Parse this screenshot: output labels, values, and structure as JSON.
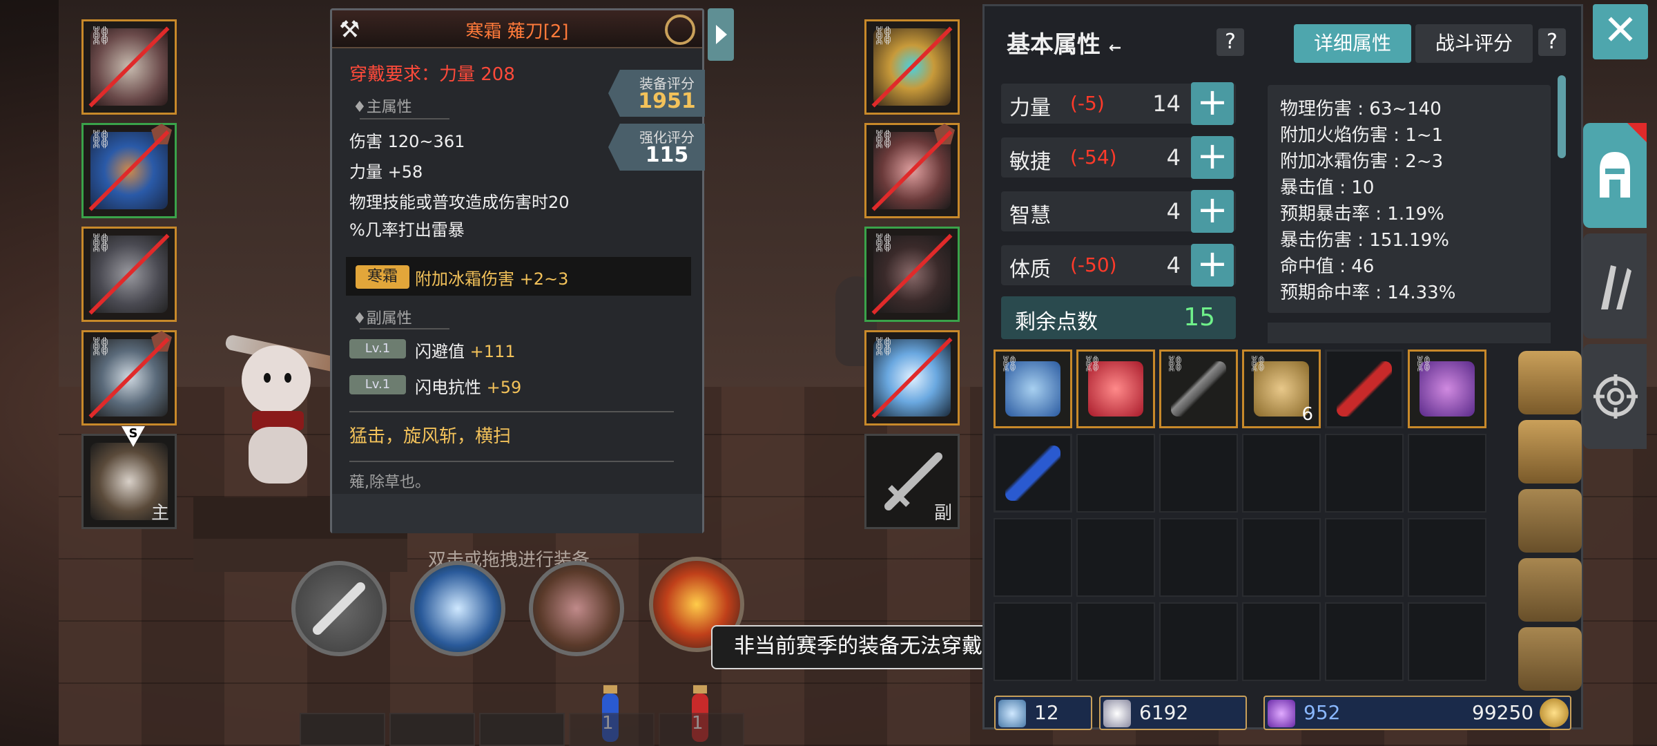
{
  "item": {
    "name": "寒霜 薙刀[2]",
    "requirement": "穿戴要求：力量 208",
    "main_attr_title": "♦主属性",
    "damage": "伤害  120~361",
    "strength": "力量 +58",
    "effect_line1": "物理技能或普攻造成伤害时20",
    "effect_line2": "%几率打出雷暴",
    "frost_badge": "寒霜",
    "frost_bonus": "附加冰霜伤害 +2~3",
    "sub_attr_title": "♦副属性",
    "sub_attrs": [
      {
        "lv": "Lv.1",
        "name": "闪避值 ",
        "value": "+111"
      },
      {
        "lv": "Lv.1",
        "name": "闪电抗性 ",
        "value": "+59"
      }
    ],
    "skills": "猛击，旋风斩，横扫",
    "lore": "薙,除草也。",
    "equip_score_label": "装备评分",
    "equip_score": "1951",
    "enhance_score_label": "强化评分",
    "enhance_score": "115"
  },
  "equip_hint": "双击或拖拽进行装备",
  "toast": "非当前赛季的装备无法穿戴",
  "slots": {
    "main_label": "主",
    "off_label": "副",
    "weapon_grade": "S"
  },
  "potions": [
    {
      "count": "1"
    },
    {
      "count": "1"
    }
  ],
  "stats_panel": {
    "title": "基本属性",
    "tab_detail": "详细属性",
    "tab_battle": "战斗评分",
    "help": "?",
    "stats": [
      {
        "name": "力量",
        "mod": "(-5)",
        "value": "14"
      },
      {
        "name": "敏捷",
        "mod": "(-54)",
        "value": "4"
      },
      {
        "name": "智慧",
        "mod": "",
        "value": "4"
      },
      {
        "name": "体质",
        "mod": "(-50)",
        "value": "4"
      }
    ],
    "remaining_label": "剩余点数",
    "remaining_value": "15",
    "details": [
      "物理伤害 : 63~140",
      "附加火焰伤害 : 1~1",
      "附加冰霜伤害 : 2~3",
      "暴击值 : 10",
      "预期暴击率 : 1.19%",
      "暴击伤害 : 151.19%",
      "命中值 : 46",
      "预期命中率 : 14.33%"
    ]
  },
  "inventory": {
    "stack_count": "6"
  },
  "currency": {
    "scrolls": "12",
    "tokens": "6192",
    "crystals": "952",
    "gold": "99250"
  },
  "close_label": "✕"
}
